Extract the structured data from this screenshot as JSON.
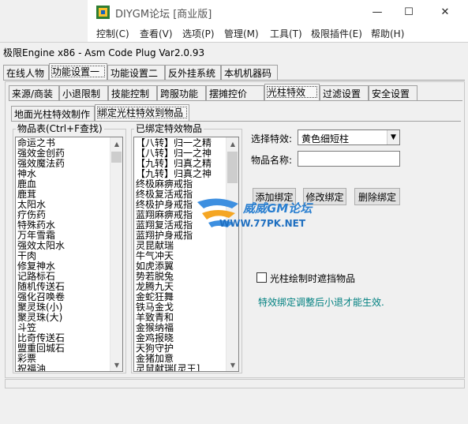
{
  "outer_window": {
    "title": "DIYGM论坛 [商业版]",
    "menu": [
      "控制(C)",
      "查看(V)",
      "选项(P)",
      "管理(M)",
      "工具(T)",
      "极限插件(E)",
      "帮助(H)"
    ],
    "minimize_glyph": "—",
    "maximize_glyph": "☐",
    "close_glyph": "✕"
  },
  "app": {
    "title": "极限Engine x86 - Asm Code Plug Var2.0.93"
  },
  "main_tabs": [
    "在线人物",
    "功能设置一",
    "功能设置二",
    "反外挂系统",
    "本机机器码"
  ],
  "sub_tabs": [
    "来源/商装",
    "小退限制",
    "技能控制",
    "跨服功能",
    "摆摊控价",
    "光柱特效",
    "过滤设置",
    "安全设置"
  ],
  "effect_tabs": [
    "地面光柱特效制作",
    "绑定光柱特效到物品"
  ],
  "item_library": {
    "label": "物品表(Ctrl+F查找)",
    "items": [
      "命运之书",
      "强效金创药",
      "强效魔法药",
      "神水",
      "鹿血",
      "鹿茸",
      "太阳水",
      "疗伤药",
      "特殊药水",
      "万年雪霜",
      "强效太阳水",
      "干肉",
      "修复神水",
      "记路标石",
      "随机传送石",
      "强化召唤卷",
      "聚灵珠(小)",
      "聚灵珠(大)",
      "斗笠",
      "比奇传送石",
      "盟重回城石",
      "彩票",
      "祝福油"
    ]
  },
  "bound_items": {
    "label": "已绑定特效物品",
    "items": [
      "【八转】归一之精",
      "【八转】归一之神",
      "【九转】归真之精",
      "【九转】归真之神",
      "终极麻痹戒指",
      "终极复活戒指",
      "终极护身戒指",
      "蓝翔麻痹戒指",
      "蓝翔复活戒指",
      "蓝翔护身戒指",
      "灵昆献瑞",
      "牛气冲天",
      "如虎添翼",
      "势若脱兔",
      "龙腾九天",
      "金蛇狂舞",
      "铁马金戈",
      "羊致青和",
      "金猴纳福",
      "金鸡报晓",
      "天狗守护",
      "金猪加意",
      "灵鼠献瑞[灵王]"
    ]
  },
  "form": {
    "effect_label": "选择特效:",
    "effect_value": "黄色细短柱",
    "item_name_label": "物品名称:",
    "item_name_value": "",
    "add_button": "添加绑定",
    "modify_button": "修改绑定",
    "delete_button": "删除绑定",
    "checkbox_label": "光柱绘制时遮挡物品",
    "checkbox_checked": false,
    "hint": "特效绑定调整后小退才能生效."
  },
  "watermark": {
    "text": "威威GM论坛",
    "url": "WWW.77PK.NET"
  },
  "colors": {
    "hint": "#008080",
    "watermark": "#2a7fd0"
  }
}
